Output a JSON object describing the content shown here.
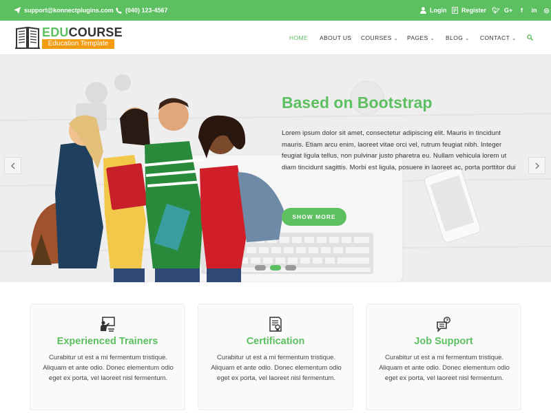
{
  "topbar": {
    "email": "support@konnectplugins.com",
    "phone": "(040) 123-4567",
    "login": "Login",
    "register": "Register",
    "social": [
      "twitter-icon",
      "google-plus-icon",
      "facebook-icon",
      "linkedin-icon",
      "instagram-icon"
    ]
  },
  "logo": {
    "edu": "EDU",
    "course": "COURSE",
    "tagline": "Education Template"
  },
  "nav": {
    "items": [
      {
        "label": "HOME",
        "active": true
      },
      {
        "label": "ABOUT US"
      },
      {
        "label": "COURSES",
        "caret": "⌄"
      },
      {
        "label": "PAGES",
        "caret": "⌄"
      },
      {
        "label": "BLOG",
        "caret": "⌄"
      },
      {
        "label": "CONTACT",
        "caret": "⌄"
      }
    ]
  },
  "hero": {
    "title": "Based on Bootstrap",
    "text": "Lorem ipsum dolor sit amet, consectetur adipiscing elit. Mauris in tincidunt mauris. Etiam arcu enim, laoreet vitae orci vel, rutrum feugiat nibh. Integer feugiat ligula tellus, non pulvinar justo pharetra eu. Nullam vehicula lorem ut diam tincidunt sagittis. Morbi est ligula, posuere in laoreet ac, porta porttitor dui",
    "button": "SHOW MORE",
    "slides": 3,
    "active_slide": 2
  },
  "features": [
    {
      "icon": "trainer-icon",
      "title": "Experienced Trainers",
      "text": "Curabitur ut est a mi fermentum tristique. Aliquam et ante odio. Donec elementum odio eget ex porta, vel laoreet nisl fermentum."
    },
    {
      "icon": "certificate-icon",
      "title": "Certification",
      "text": "Curabitur ut est a mi fermentum tristique. Aliquam et ante odio. Donec elementum odio eget ex porta, vel laoreet nisl fermentum."
    },
    {
      "icon": "support-chat-icon",
      "title": "Job Support",
      "text": "Curabitur ut est a mi fermentum tristique. Aliquam et ante odio. Donec elementum odio eget ex porta, vel laoreet nisl fermentum."
    }
  ],
  "colors": {
    "accent": "#5cbf60",
    "tagline_bg": "#f39c12"
  }
}
